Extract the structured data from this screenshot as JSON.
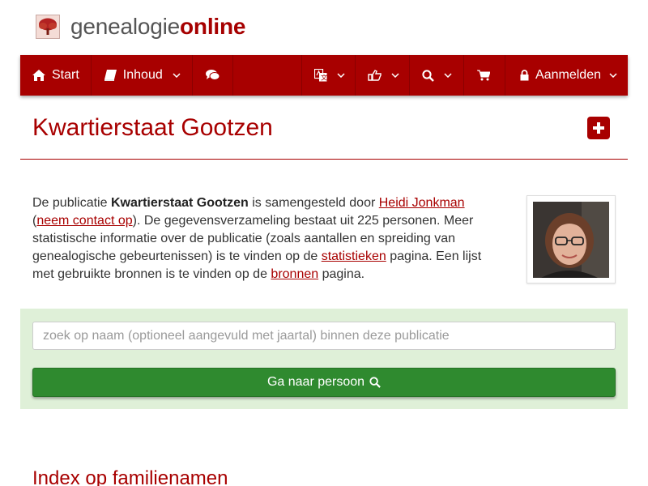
{
  "logo": {
    "text_a": "genealogie",
    "text_b": "online"
  },
  "nav": {
    "start": "Start",
    "inhoud": "Inhoud",
    "aanmelden": "Aanmelden"
  },
  "page": {
    "title": "Kwartierstaat Gootzen"
  },
  "description": {
    "p1": "De publicatie ",
    "pub_name": "Kwartierstaat Gootzen",
    "p2": " is samengesteld door ",
    "author": "Heidi Jonkman",
    "p3": "(",
    "contact": "neem contact op",
    "p4": "). De gegevensverzameling bestaat uit 225 personen. Meer statistische informatie over de publicatie (zoals aantallen en spreiding van genealogische gebeurtenissen) is te vinden op de ",
    "stats": "statistieken",
    "p5": " pagina. Een lijst met gebruikte bronnen is te vinden op de ",
    "sources": "bronnen",
    "p6": " pagina."
  },
  "search": {
    "placeholder": "zoek op naam (optioneel aangevuld met jaartal) binnen deze publicatie",
    "button": "Ga naar persoon"
  },
  "section": {
    "heading": "Index op familienamen"
  },
  "colors": {
    "brand": "#a80000",
    "panel": "#dff0d8",
    "button": "#2f8a2f"
  }
}
